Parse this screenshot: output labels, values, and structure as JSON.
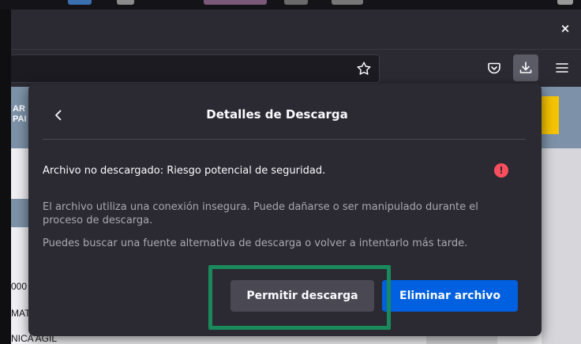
{
  "window": {
    "close_glyph": "×"
  },
  "toolbar": {
    "bookmark_icon": "star-icon",
    "pocket_icon": "pocket-icon",
    "download_icon": "download-icon",
    "menu_icon": "hamburger-menu-icon"
  },
  "page": {
    "header_line1": "AR",
    "header_line2": "PAI",
    "rows": [
      {
        "text": "000"
      },
      {
        "text": "MAT"
      },
      {
        "text": "NICA AGIL"
      }
    ]
  },
  "panel": {
    "back_glyph": "‹",
    "title": "Detalles de Descarga",
    "main_message": "Archivo no descargado: Riesgo potencial de seguridad.",
    "warning_glyph": "!",
    "description": "El archivo utiliza una conexión insegura. Puede dañarse o ser manipulado durante el proceso de descarga.",
    "hint": "Puedes buscar una fuente alternativa de descarga o volver a intentarlo más tarde.",
    "allow_button": "Permitir descarga",
    "delete_button": "Eliminar archivo"
  },
  "colors": {
    "panel_bg": "#2b2a33",
    "primary_button": "#0060df",
    "secondary_button": "#4a4953",
    "warning": "#ff4f5e",
    "highlight": "#1a8a5c"
  }
}
